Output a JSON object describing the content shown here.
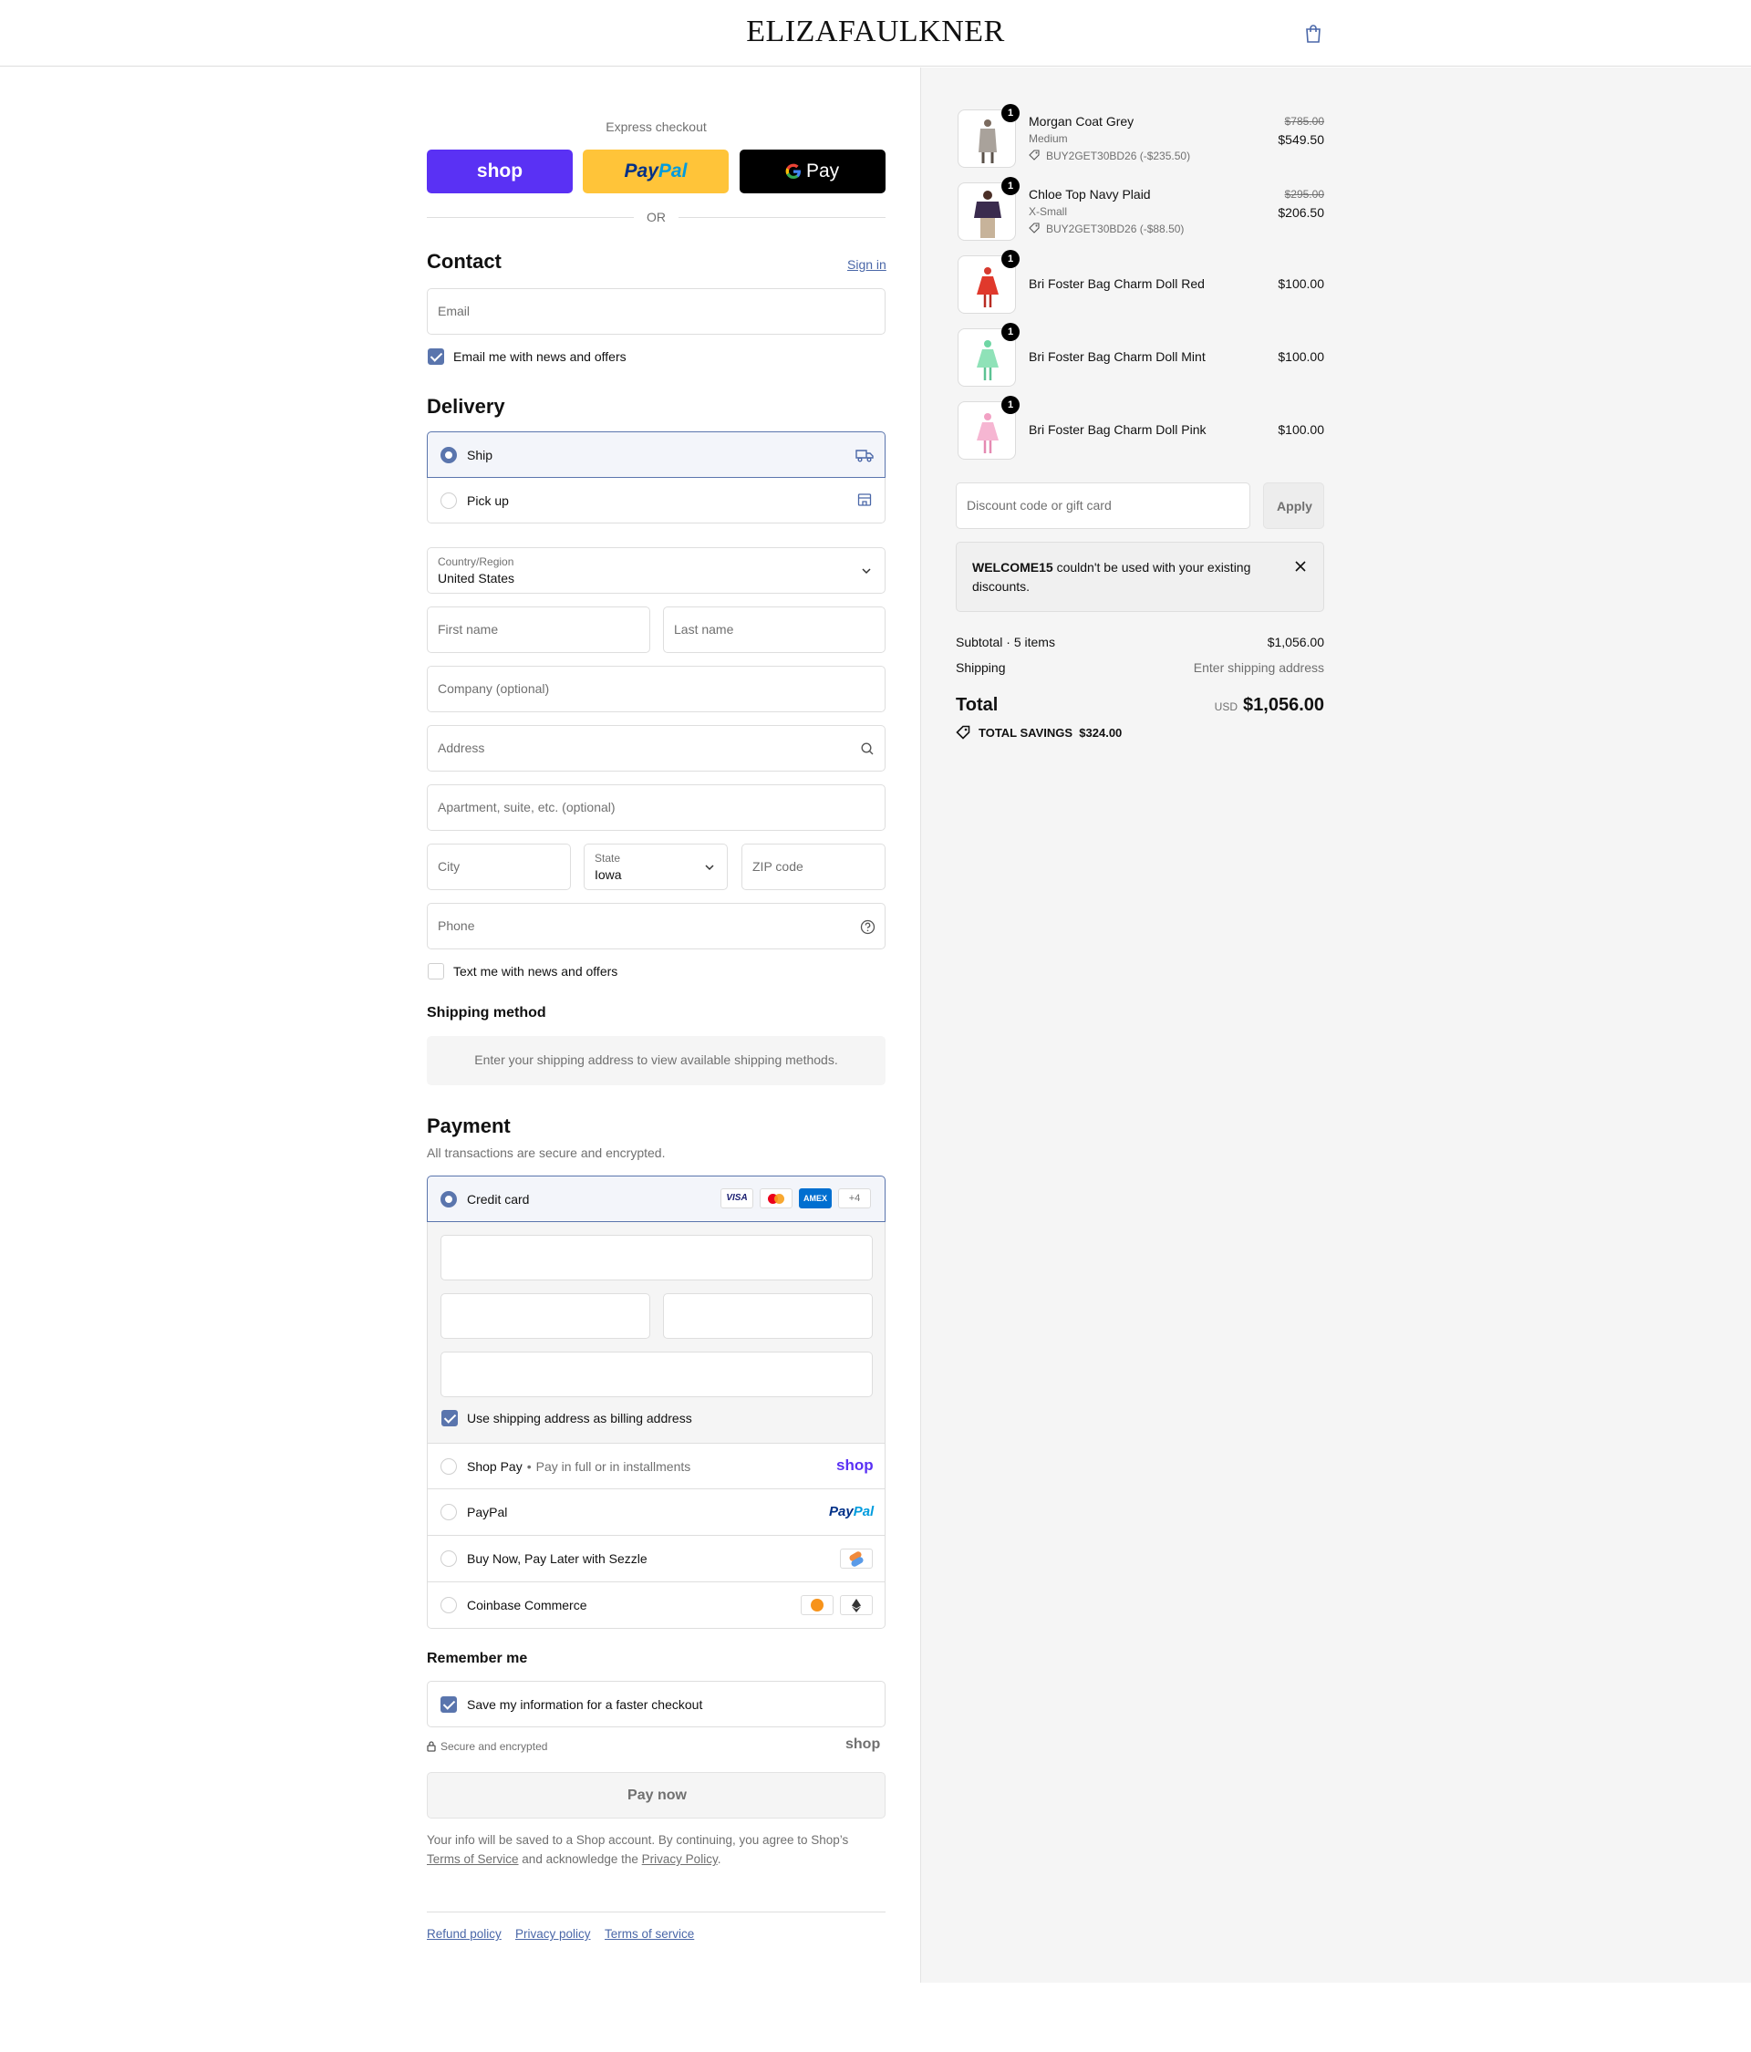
{
  "header": {
    "brand": "ELIZAFAULKNER"
  },
  "express": {
    "label": "Express checkout",
    "shop_label": "shop",
    "paypal_pay": "Pay",
    "paypal_pal": "Pal",
    "gpay_label": "Pay",
    "or_label": "OR"
  },
  "contact": {
    "title": "Contact",
    "sign_in": "Sign in",
    "email_placeholder": "Email",
    "news_label": "Email me with news and offers"
  },
  "delivery": {
    "title": "Delivery",
    "ship_label": "Ship",
    "pickup_label": "Pick up",
    "country_label": "Country/Region",
    "country_value": "United States",
    "first_name": "First name",
    "last_name": "Last name",
    "company": "Company (optional)",
    "address": "Address",
    "apartment": "Apartment, suite, etc. (optional)",
    "city": "City",
    "state_label": "State",
    "state_value": "Iowa",
    "zip": "ZIP code",
    "phone": "Phone",
    "text_label": "Text me with news and offers"
  },
  "shipping_method": {
    "title": "Shipping method",
    "message": "Enter your shipping address to view available shipping methods."
  },
  "payment": {
    "title": "Payment",
    "subtitle": "All transactions are secure and encrypted.",
    "credit_card": "Credit card",
    "visa": "VISA",
    "amex": "AMEX",
    "more_cards": "+4",
    "billing_label": "Use shipping address as billing address",
    "shop_pay": "Shop Pay",
    "shop_pay_sub": "Pay in full or in installments",
    "shop_pay_logo": "shop",
    "paypal": "PayPal",
    "paypal_logo_pay": "Pay",
    "paypal_logo_pal": "Pal",
    "sezzle": "Buy Now, Pay Later with Sezzle",
    "coinbase": "Coinbase Commerce"
  },
  "remember": {
    "title": "Remember me",
    "save_label": "Save my information for a faster checkout",
    "secure_label": "Secure and encrypted",
    "shop_logo": "shop"
  },
  "pay_now": "Pay now",
  "legal": {
    "line1": "Your info will be saved to a Shop account. By continuing, you agree to Shop’s",
    "tos": "Terms of Service",
    "mid": "and acknowledge the",
    "privacy": "Privacy Policy",
    "end": "."
  },
  "footer_links": [
    "Refund policy",
    "Privacy policy",
    "Terms of service"
  ],
  "cart": {
    "items": [
      {
        "name": "Morgan Coat Grey",
        "variant": "Medium",
        "discount": "BUY2GET30BD26 (-$235.50)",
        "old_price": "$785.00",
        "price": "$549.50",
        "qty": "1"
      },
      {
        "name": "Chloe Top Navy Plaid",
        "variant": "X-Small",
        "discount": "BUY2GET30BD26 (-$88.50)",
        "old_price": "$295.00",
        "price": "$206.50",
        "qty": "1"
      },
      {
        "name": "Bri Foster Bag Charm Doll Red",
        "price": "$100.00",
        "qty": "1"
      },
      {
        "name": "Bri Foster Bag Charm Doll Mint",
        "price": "$100.00",
        "qty": "1"
      },
      {
        "name": "Bri Foster Bag Charm Doll Pink",
        "price": "$100.00",
        "qty": "1"
      }
    ],
    "discount_placeholder": "Discount code or gift card",
    "apply": "Apply",
    "notice_code": "WELCOME15",
    "notice_text": " couldn't be used with your existing",
    "notice_text2": "discounts.",
    "subtotal_label": "Subtotal · 5 items",
    "subtotal_value": "$1,056.00",
    "shipping_label": "Shipping",
    "shipping_value": "Enter shipping address",
    "total_label": "Total",
    "currency": "USD",
    "total_value": "$1,056.00",
    "savings_label": "TOTAL SAVINGS",
    "savings_value": "$324.00"
  },
  "colors": {
    "accent": "#5a75ad",
    "shop": "#5a31f4",
    "paypal": "#ffc439"
  }
}
